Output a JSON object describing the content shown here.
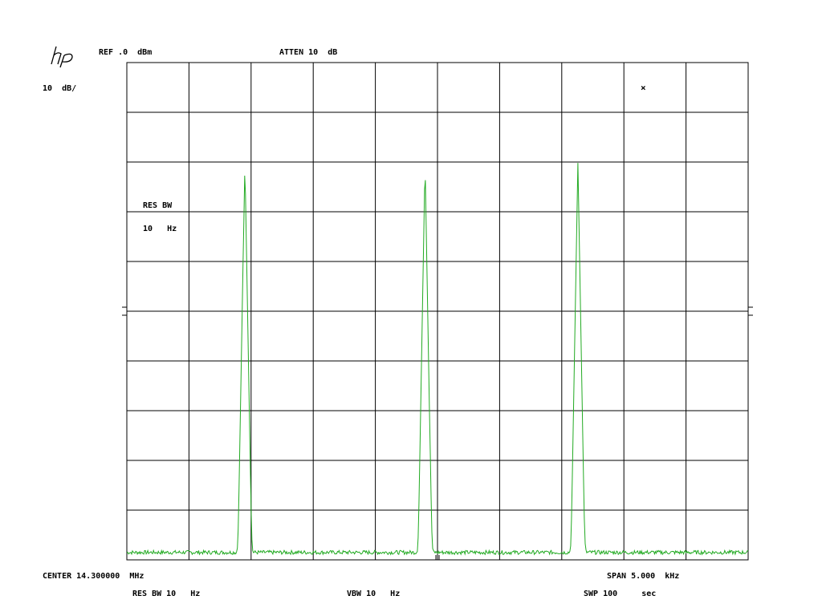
{
  "header": {
    "ref_level": "REF .0  dBm",
    "attenuation": "ATTEN 10  dB",
    "scale": "10  dB/"
  },
  "side": {
    "res_bw_title": "RES BW",
    "res_bw_value": "10   Hz",
    "marker_symbol": "×"
  },
  "footer": {
    "center": "CENTER 14.300000  MHz",
    "span": "SPAN 5.000  kHz",
    "res_bw": "RES BW 10   Hz",
    "vbw": "VBW 10   Hz",
    "sweep": "SWP 100     sec"
  },
  "colors": {
    "trace": "#22aa22",
    "grid": "#000000"
  },
  "chart_data": {
    "type": "line",
    "x_center_mhz": 14.3,
    "x_span_khz": 5.0,
    "xlim_khz": [
      -2.5,
      2.5
    ],
    "ylim_db": [
      -100,
      0
    ],
    "grid": true,
    "divisions": {
      "x": 10,
      "y": 10
    },
    "noise_floor_db": -98.5,
    "peaks": [
      {
        "offset_khz": -1.55,
        "level_db": -20
      },
      {
        "offset_khz": -0.1,
        "level_db": -20
      },
      {
        "offset_khz": 1.13,
        "level_db": -20
      }
    ]
  }
}
